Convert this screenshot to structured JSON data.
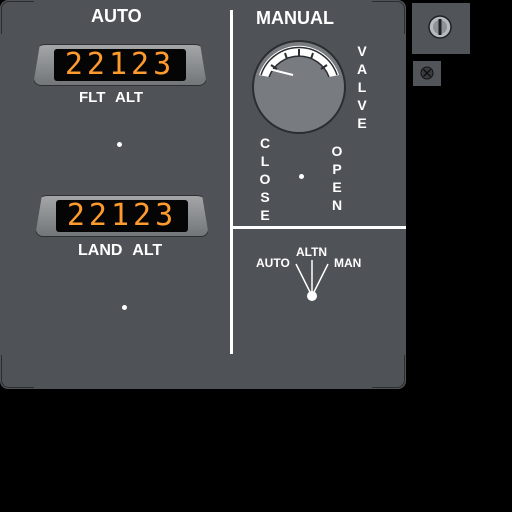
{
  "auto_section": {
    "title": "AUTO",
    "flt_alt": {
      "label": "FLT ALT",
      "value": "22123"
    },
    "land_alt": {
      "label": "LAND ALT",
      "value": "22123"
    }
  },
  "manual_section": {
    "title": "MANUAL",
    "valve_label": "VALVE",
    "close_label": "CLOSE",
    "open_label": "OPEN",
    "mode_selector": {
      "auto_label": "AUTO",
      "altn_label": "ALTN",
      "man_label": "MAN",
      "selected": "ALTN"
    }
  },
  "colors": {
    "panel": "#4f5357",
    "display_digits": "#ff9a2e",
    "labels": "#ffffff"
  },
  "icons": [
    "valve-position-gauge-icon",
    "mode-selector-knob-icon",
    "screw-icon",
    "indicator-light-icon"
  ]
}
